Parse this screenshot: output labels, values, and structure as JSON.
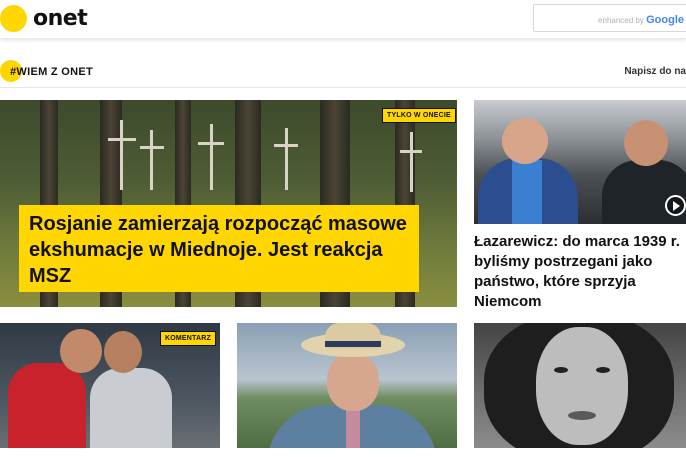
{
  "header": {
    "logo_text": "onet",
    "search": {
      "placeholder": "",
      "enhanced_by": "enhanced by",
      "google": "Google"
    }
  },
  "section": {
    "title": "#WIEM Z ONET",
    "write_link": "Napisz do na"
  },
  "articles": {
    "main": {
      "tag": "TYLKO W ONECIE",
      "headline": "Rosjanie zamierzają rozpocząć masowe ekshumacje w Miednoje. Jest reakcja MSZ"
    },
    "video": {
      "headline": "Łazarewicz: do marca 1939 r. byliśmy postrzegani jako państwo, które sprzyja Niemcom"
    },
    "football": {
      "tag": "KOMENTARZ"
    },
    "hat": {},
    "portrait": {}
  },
  "colors": {
    "accent": "#ffd600",
    "text": "#111111"
  }
}
